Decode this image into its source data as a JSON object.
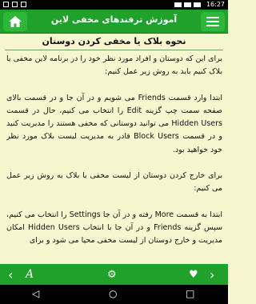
{
  "status_bar": {
    "time": "16:27"
  },
  "header": {
    "title": "آموزش ترفندهای مخفی لاین"
  },
  "page": {
    "title": "نحوه بلاک یا مخفی کردن دوستان",
    "paragraphs": [
      "برای این که دوستان و افراد مورد نظر خود را در برنامه لاین مخفی یا بلاک کنیم باید به روش زیر عمل کنیم:",
      "ابتدا وارد قسمت Friends می شویم و در آن جا و در قسمت بالای صفحه سمت چپ گزینه Edit را انتخاب می کنیم، حال در قسمت Hidden Users می توانید دوستانی که مخفی هستند را مدیریت کنید و در قسمت Block Users قادر به مدیریت لیست بلاک مورد نظر خود خواهید بود.",
      "برای خارج کردن دوستان از لیست مخفی یا بلاک به روش زیر عمل می کنیم:",
      "ابتدا به قسمت More رفته و در آن جا Settings را انتخاب می کنیم، سپس گزینه Friends و در آن جا با انتخاب Hidden Users امکان مدیریت و خارج دوستان از لیست مخفی محیا می شود و برای"
    ]
  },
  "icons": {
    "home": "home-icon",
    "menu": "menu-icon",
    "prev": "chevron-left-icon",
    "font": "font-size-icon",
    "settings": "gear-icon",
    "favorite": "heart-icon",
    "next": "chevron-right-icon"
  },
  "colors": {
    "header": "#1fa12b",
    "background": "#f8f6cf"
  }
}
